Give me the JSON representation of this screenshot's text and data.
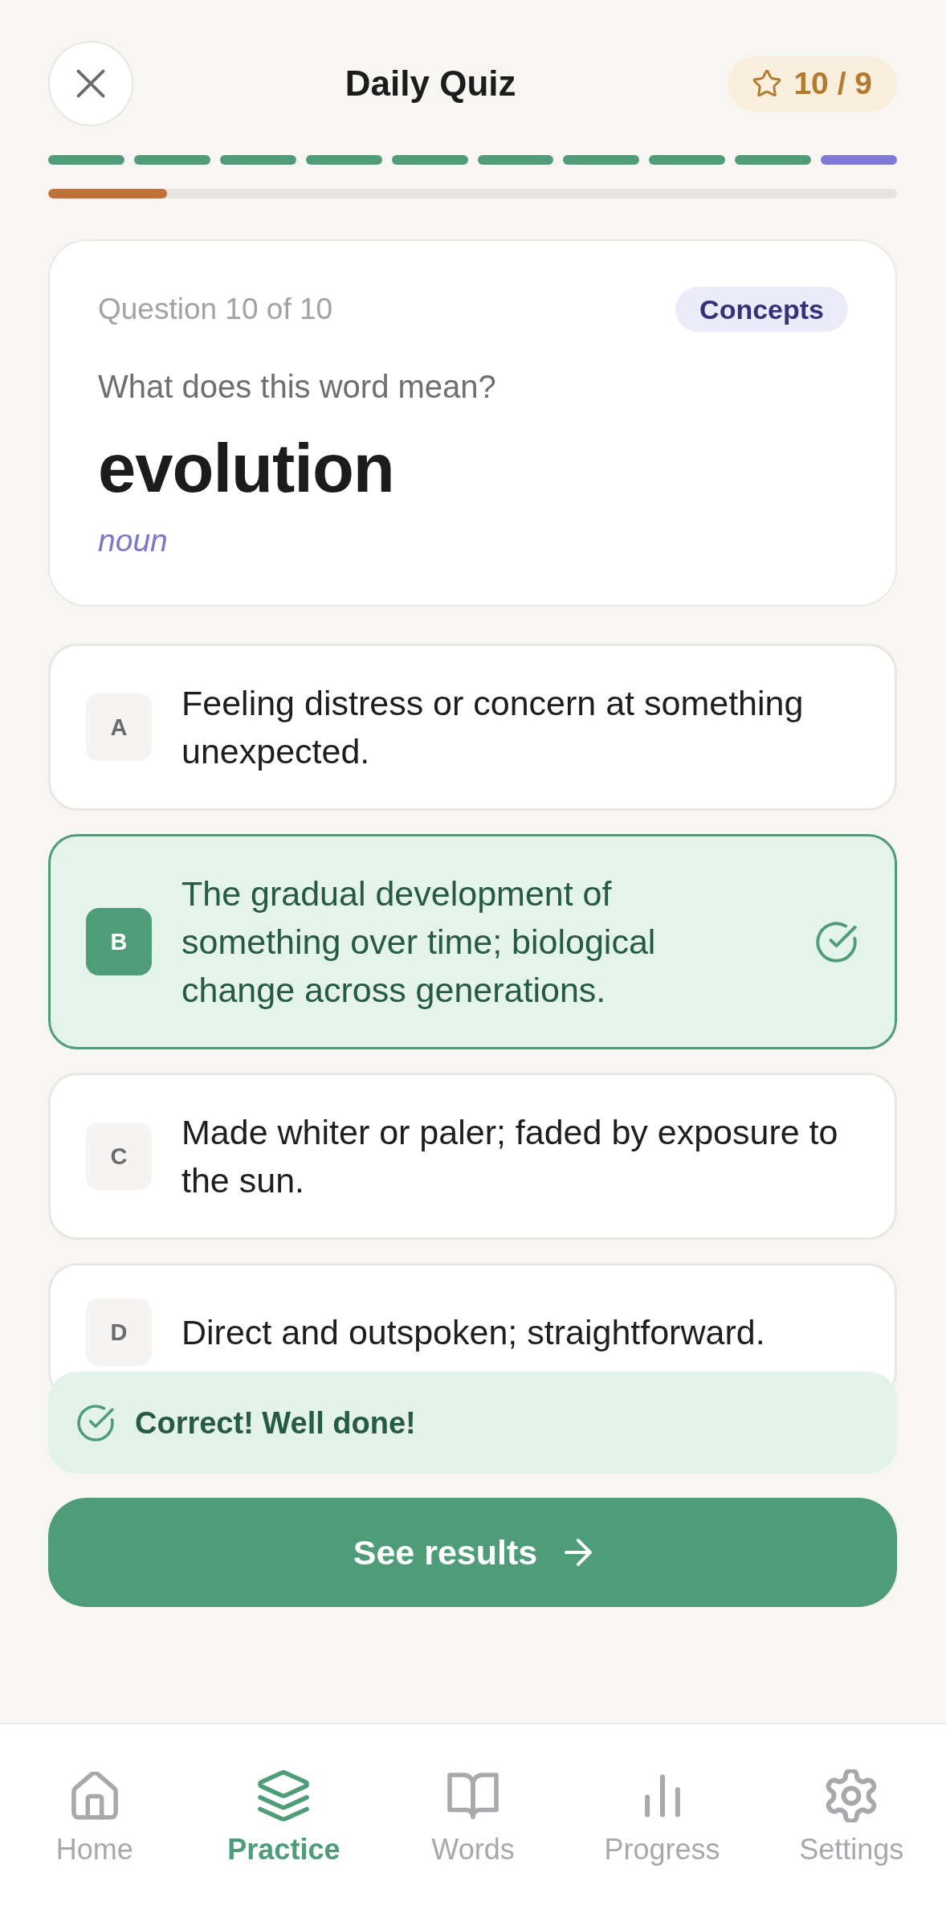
{
  "header": {
    "title": "Daily Quiz",
    "score": "10 / 9"
  },
  "progress_segments": [
    {
      "color": "#4f9c79"
    },
    {
      "color": "#4f9c79"
    },
    {
      "color": "#4f9c79"
    },
    {
      "color": "#4f9c79"
    },
    {
      "color": "#4f9c79"
    },
    {
      "color": "#4f9c79"
    },
    {
      "color": "#4f9c79"
    },
    {
      "color": "#4f9c79"
    },
    {
      "color": "#4f9c79"
    },
    {
      "color": "#7f79d6"
    }
  ],
  "progress_bar": {
    "level": 0.14
  },
  "question": {
    "counter": "Question 10 of 10",
    "category": "Concepts",
    "prompt": "What does this word mean?",
    "word": "evolution",
    "part_of_speech": "noun"
  },
  "options": [
    {
      "letter": "A",
      "text": "Feeling distress or concern at something unexpected.",
      "selected": false,
      "correct": false
    },
    {
      "letter": "B",
      "text": "The gradual development of something over time; biological change across generations.",
      "selected": true,
      "correct": true
    },
    {
      "letter": "C",
      "text": "Made whiter or paler; faded by exposure to the sun.",
      "selected": false,
      "correct": false
    },
    {
      "letter": "D",
      "text": "Direct and outspoken; straightforward.",
      "selected": false,
      "correct": false
    }
  ],
  "feedback": {
    "kind": "correct",
    "message": "Correct! Well done!"
  },
  "primary_button": {
    "label": "See results"
  },
  "nav": [
    {
      "kind": "home",
      "label": "Home",
      "selected": false
    },
    {
      "kind": "layers",
      "label": "Practice",
      "selected": true
    },
    {
      "kind": "book",
      "label": "Words",
      "selected": false
    },
    {
      "kind": "chart",
      "label": "Progress",
      "selected": false
    },
    {
      "kind": "gear",
      "label": "Settings",
      "selected": false
    }
  ]
}
